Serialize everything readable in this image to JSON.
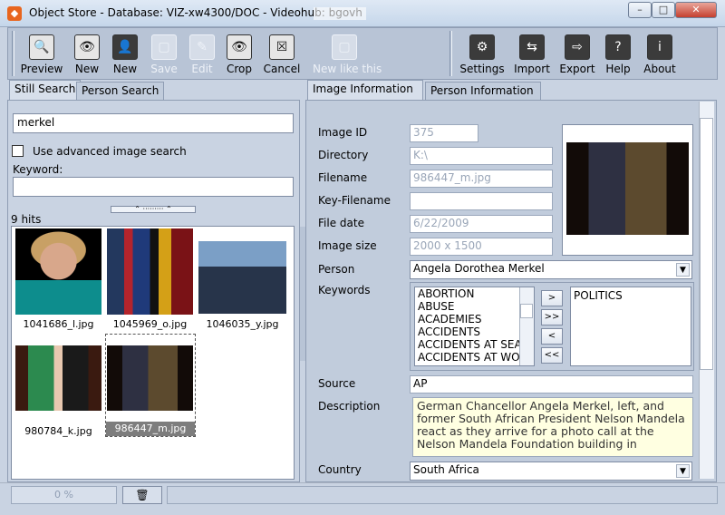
{
  "window": {
    "title": "Object Store  -  Database: VIZ-xw4300/DOC  -  Videohub: bgovh",
    "min_glyph": "–",
    "max_glyph": "□",
    "close_glyph": "✕"
  },
  "toolbar": {
    "buttons": [
      {
        "label": "Preview",
        "icon": "magnifier-icon",
        "glyph": "🔍"
      },
      {
        "label": "New",
        "icon": "eye-icon",
        "glyph": "👁"
      },
      {
        "label": "New",
        "icon": "person-silhouette-icon",
        "glyph": "👤"
      },
      {
        "label": "Save",
        "icon": "save-icon",
        "glyph": "▢"
      },
      {
        "label": "Edit",
        "icon": "edit-icon",
        "glyph": "✎"
      },
      {
        "label": "Crop",
        "icon": "crop-eye-icon",
        "glyph": "👁"
      },
      {
        "label": "Cancel",
        "icon": "cancel-icon",
        "glyph": "☒"
      },
      {
        "label": "New like this",
        "icon": "new-like-this-icon",
        "glyph": "▢"
      },
      {
        "label": "Settings",
        "icon": "settings-icon",
        "glyph": "⚙"
      },
      {
        "label": "Import",
        "icon": "import-icon",
        "glyph": "⇆"
      },
      {
        "label": "Export",
        "icon": "export-icon",
        "glyph": "⇨"
      },
      {
        "label": "Help",
        "icon": "help-icon",
        "glyph": "?"
      },
      {
        "label": "About",
        "icon": "about-icon",
        "glyph": "i"
      }
    ]
  },
  "left_tabs": [
    "Still Search",
    "Person Search"
  ],
  "search": {
    "query": "merkel",
    "advanced_label": "Use advanced image search",
    "keyword_label": "Keyword:",
    "keyword_value": "",
    "splitter_glyph": "⌃ ········· ⌃",
    "hits": "9 hits"
  },
  "thumbnails": [
    {
      "caption": "1041686_l.jpg"
    },
    {
      "caption": "1045969_o.jpg"
    },
    {
      "caption": "1046035_y.jpg"
    },
    {
      "caption": "980784_k.jpg"
    },
    {
      "caption": "986447_m.jpg"
    }
  ],
  "right_tabs": [
    "Image Information",
    "Person Information"
  ],
  "image_info": {
    "image_id_label": "Image ID",
    "image_id": "375",
    "directory_label": "Directory",
    "directory": "K:\\",
    "filename_label": "Filename",
    "filename": "986447_m.jpg",
    "key_filename_label": "Key-Filename",
    "key_filename": "",
    "file_date_label": "File date",
    "file_date": "6/22/2009",
    "image_size_label": "Image size",
    "image_size": "2000 x 1500",
    "person_label": "Person",
    "person": "Angela Dorothea Merkel",
    "keywords_label": "Keywords",
    "keyword_list": [
      "ABORTION",
      "ABUSE",
      "ACADEMIES",
      "ACCIDENTS",
      "ACCIDENTS AT SEA",
      "ACCIDENTS AT WORK"
    ],
    "move_buttons": [
      ">",
      ">>",
      "<",
      "<<"
    ],
    "selected_keywords": [
      "POLITICS"
    ],
    "source_label": "Source",
    "source": "AP",
    "description_label": "Description",
    "description": "German Chancellor Angela Merkel, left, and former South African President Nelson Mandela react as they arrive for a photo call at the Nelson Mandela Foundation building in",
    "country_label": "Country",
    "country": "South Africa",
    "dropdown_glyph": "▼"
  },
  "status": {
    "progress": "0 %",
    "trash_glyph": "🗑"
  }
}
